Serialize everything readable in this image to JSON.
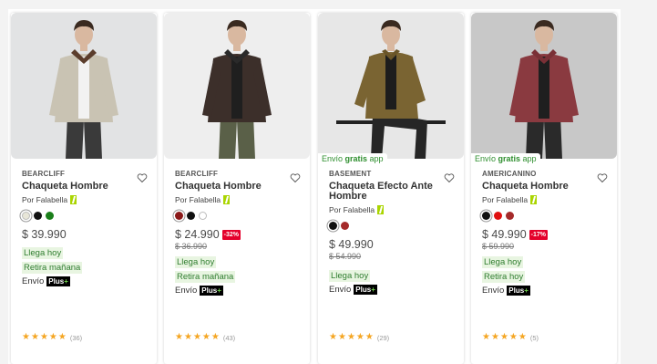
{
  "products": [
    {
      "brand": "BEARCLIFF",
      "title": "Chaqueta Hombre",
      "seller": "Por Falabella",
      "price": "$ 39.990",
      "discount": "",
      "old_price": "",
      "shipping_badge": null,
      "tags": [
        "Llega hoy",
        "Retira mañana"
      ],
      "envio_label": "Envío",
      "plus_label": "Plus",
      "rating_count": "(36)",
      "swatches": [
        "#e8e6d8",
        "#111111",
        "#1a7f1a"
      ],
      "image_colors": {
        "bg": "#e2e3e4",
        "jacket": "#c9c3b3",
        "collar": "#5b3d2c",
        "pants": "#3a3a3a"
      }
    },
    {
      "brand": "BEARCLIFF",
      "title": "Chaqueta Hombre",
      "seller": "Por Falabella",
      "price": "$ 24.990",
      "discount": "-32%",
      "old_price": "$ 36.990",
      "shipping_badge": null,
      "tags": [
        "Llega hoy",
        "Retira mañana"
      ],
      "envio_label": "Envío",
      "plus_label": "Plus",
      "rating_count": "(43)",
      "swatches": [
        "#8b1a1a",
        "#111111",
        "#ffffff"
      ],
      "image_colors": {
        "bg": "#eeeeee",
        "jacket": "#3c2f2a",
        "collar": "#2a2a2a",
        "pants": "#5a6048"
      }
    },
    {
      "brand": "BASEMENT",
      "title": "Chaqueta Efecto Ante Hombre",
      "seller": "Por Falabella",
      "price": "$ 49.990",
      "discount": "",
      "old_price": "$ 54.990",
      "shipping_badge": {
        "pre": "Envío ",
        "bold": "gratis",
        "post": " app"
      },
      "tags": [
        "Llega hoy"
      ],
      "envio_label": "Envío",
      "plus_label": "Plus",
      "rating_count": "(29)",
      "swatches": [
        "#111111",
        "#a52a2a"
      ],
      "image_colors": {
        "bg": "#e7e7e7",
        "jacket": "#7a6432",
        "collar": "#6a5528",
        "pants": "#262626"
      }
    },
    {
      "brand": "AMERICANINO",
      "title": "Chaqueta Hombre",
      "seller": "Por Falabella",
      "price": "$ 49.990",
      "discount": "-17%",
      "old_price": "$ 59.990",
      "shipping_badge": {
        "pre": "Envío ",
        "bold": "gratis",
        "post": " app"
      },
      "tags": [
        "Llega hoy",
        "Retira hoy"
      ],
      "envio_label": "Envío",
      "plus_label": "Plus",
      "rating_count": "(5)",
      "swatches": [
        "#111111",
        "#e01010",
        "#a52a2a"
      ],
      "image_colors": {
        "bg": "#c8c8c8",
        "jacket": "#8a3a40",
        "collar": "#7a3036",
        "pants": "#2a2a2a"
      }
    }
  ],
  "colors": {
    "accent_green": "#2f7d2f",
    "tag_bg": "#e8f5e1",
    "discount_red": "#e4002b",
    "star": "#f5a623"
  }
}
